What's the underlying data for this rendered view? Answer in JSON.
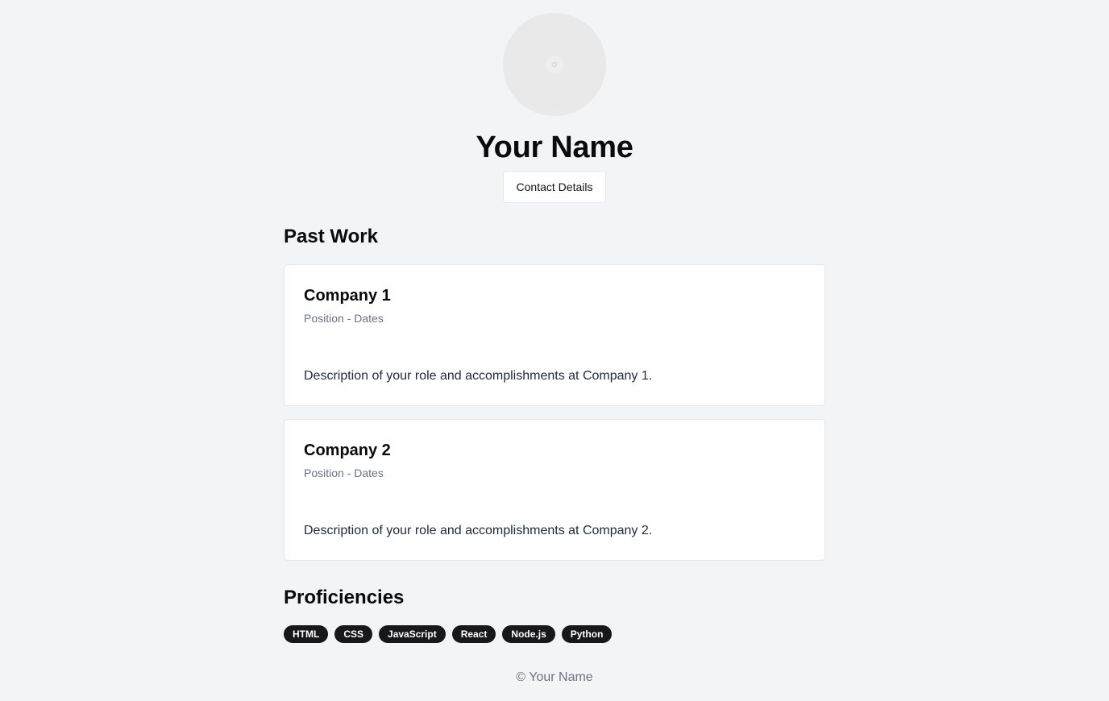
{
  "profile": {
    "name": "Your Name",
    "contact_button": "Contact Details"
  },
  "past_work": {
    "title": "Past Work",
    "items": [
      {
        "company": "Company 1",
        "meta": "Position - Dates",
        "description": "Description of your role and accomplishments at Company 1."
      },
      {
        "company": "Company 2",
        "meta": "Position - Dates",
        "description": "Description of your role and accomplishments at Company 2."
      }
    ]
  },
  "proficiencies": {
    "title": "Proficiencies",
    "skills": [
      "HTML",
      "CSS",
      "JavaScript",
      "React",
      "Node.js",
      "Python"
    ]
  },
  "footer": {
    "text": "© Your Name"
  },
  "colors": {
    "background": "#f3f4f6",
    "pill": "#18181b",
    "muted": "#6b7280"
  },
  "icons": {
    "avatar": "avatar-placeholder-icon"
  }
}
